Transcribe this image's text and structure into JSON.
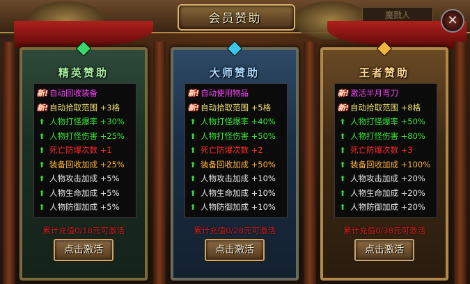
{
  "window": {
    "title": "会员赞助",
    "background_sign": "魔戮人",
    "close_label": "✕"
  },
  "panels": [
    {
      "title": "精英赞助",
      "gem_color": "#3ad86a",
      "rows": [
        {
          "icon": "新!",
          "text": "自动回收装备",
          "color": "#ff44ff"
        },
        {
          "icon": "新!",
          "text": "自动拾取范围 +3格",
          "color": "#f0e070"
        },
        {
          "icon": "⬆",
          "text": "人物打怪爆率 +30%",
          "color": "#38e838"
        },
        {
          "icon": "⬆",
          "text": "人物打怪伤害 +25%",
          "color": "#38e838"
        },
        {
          "icon": "⬆",
          "text": "死亡防爆次数 +1",
          "color": "#ff2a2a"
        },
        {
          "icon": "⬆",
          "text": "装备回收加成 +25%",
          "color": "#ffb23a"
        },
        {
          "icon": "⬆",
          "text": "人物攻击加成 +5%",
          "color": "#e8e8e8"
        },
        {
          "icon": "⬆",
          "text": "人物生命加成 +5%",
          "color": "#e8e8e8"
        },
        {
          "icon": "⬆",
          "text": "人物防御加成 +5%",
          "color": "#e8e8e8"
        }
      ],
      "requirement": "累计充值0/18元可激活",
      "button": "点击激活"
    },
    {
      "title": "大师赞助",
      "gem_color": "#3ac8e8",
      "rows": [
        {
          "icon": "新!",
          "text": "自动使用物品",
          "color": "#ff44ff"
        },
        {
          "icon": "新!",
          "text": "自动拾取范围 +5格",
          "color": "#f0e070"
        },
        {
          "icon": "⬆",
          "text": "人物打怪爆率 +40%",
          "color": "#38e838"
        },
        {
          "icon": "⬆",
          "text": "人物打怪伤害 +50%",
          "color": "#38e838"
        },
        {
          "icon": "⬆",
          "text": "死亡防爆次数 +2",
          "color": "#ff2a2a"
        },
        {
          "icon": "⬆",
          "text": "装备回收加成 +50%",
          "color": "#ffb23a"
        },
        {
          "icon": "⬆",
          "text": "人物攻击加成 +10%",
          "color": "#e8e8e8"
        },
        {
          "icon": "⬆",
          "text": "人物生命加成 +10%",
          "color": "#e8e8e8"
        },
        {
          "icon": "⬆",
          "text": "人物防御加成 +10%",
          "color": "#e8e8e8"
        }
      ],
      "requirement": "累计充值0/28元可激活",
      "button": "点击激活"
    },
    {
      "title": "王者赞助",
      "gem_color": "#f0b43a",
      "rows": [
        {
          "icon": "新!",
          "text": "激活半月弯刀",
          "color": "#ff44ff"
        },
        {
          "icon": "新!",
          "text": "自动拾取范围 +8格",
          "color": "#f0e070"
        },
        {
          "icon": "⬆",
          "text": "人物打怪爆率 +50%",
          "color": "#38e838"
        },
        {
          "icon": "⬆",
          "text": "人物打怪伤害 +80%",
          "color": "#38e838"
        },
        {
          "icon": "⬆",
          "text": "死亡防爆次数 +3",
          "color": "#ff2a2a"
        },
        {
          "icon": "⬆",
          "text": "装备回收加成 +100%",
          "color": "#ffb23a"
        },
        {
          "icon": "⬆",
          "text": "人物攻击加成 +20%",
          "color": "#e8e8e8"
        },
        {
          "icon": "⬆",
          "text": "人物生命加成 +20%",
          "color": "#e8e8e8"
        },
        {
          "icon": "⬆",
          "text": "人物防御加成 +20%",
          "color": "#e8e8e8"
        }
      ],
      "requirement": "累计充值0/38元可激活",
      "button": "点击激活"
    }
  ]
}
